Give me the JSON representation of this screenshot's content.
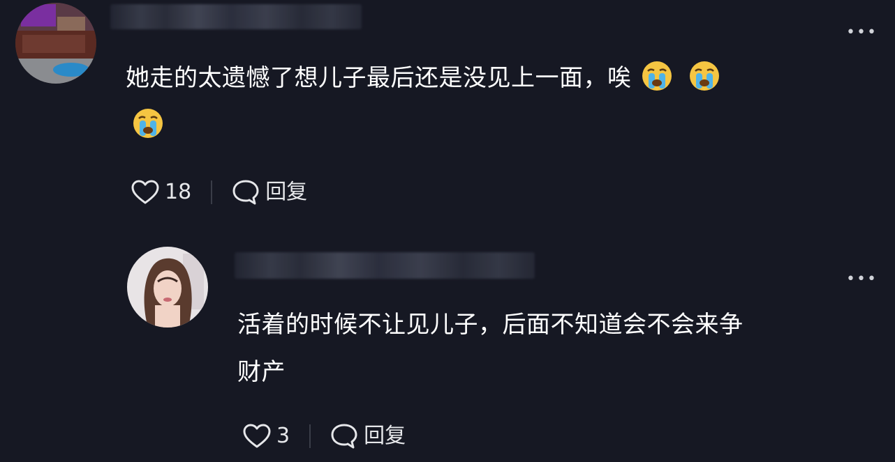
{
  "comments": [
    {
      "text_line1": "她走的太遗憾了想儿子最后还是没见上一面，唉",
      "emojis": [
        "loudly-crying-face",
        "loudly-crying-face",
        "loudly-crying-face"
      ],
      "likes": "18",
      "reply_label": "回复"
    },
    {
      "text_line1": "活着的时候不让见儿子，后面不知道会不会来争",
      "text_line2": "财产",
      "likes": "3",
      "reply_label": "回复"
    }
  ],
  "colors": {
    "background": "#161823",
    "text": "#ffffff",
    "secondary": "#e6e7ea",
    "emoji_yellow": "#f5c542",
    "emoji_tears": "#4fb3e8"
  }
}
